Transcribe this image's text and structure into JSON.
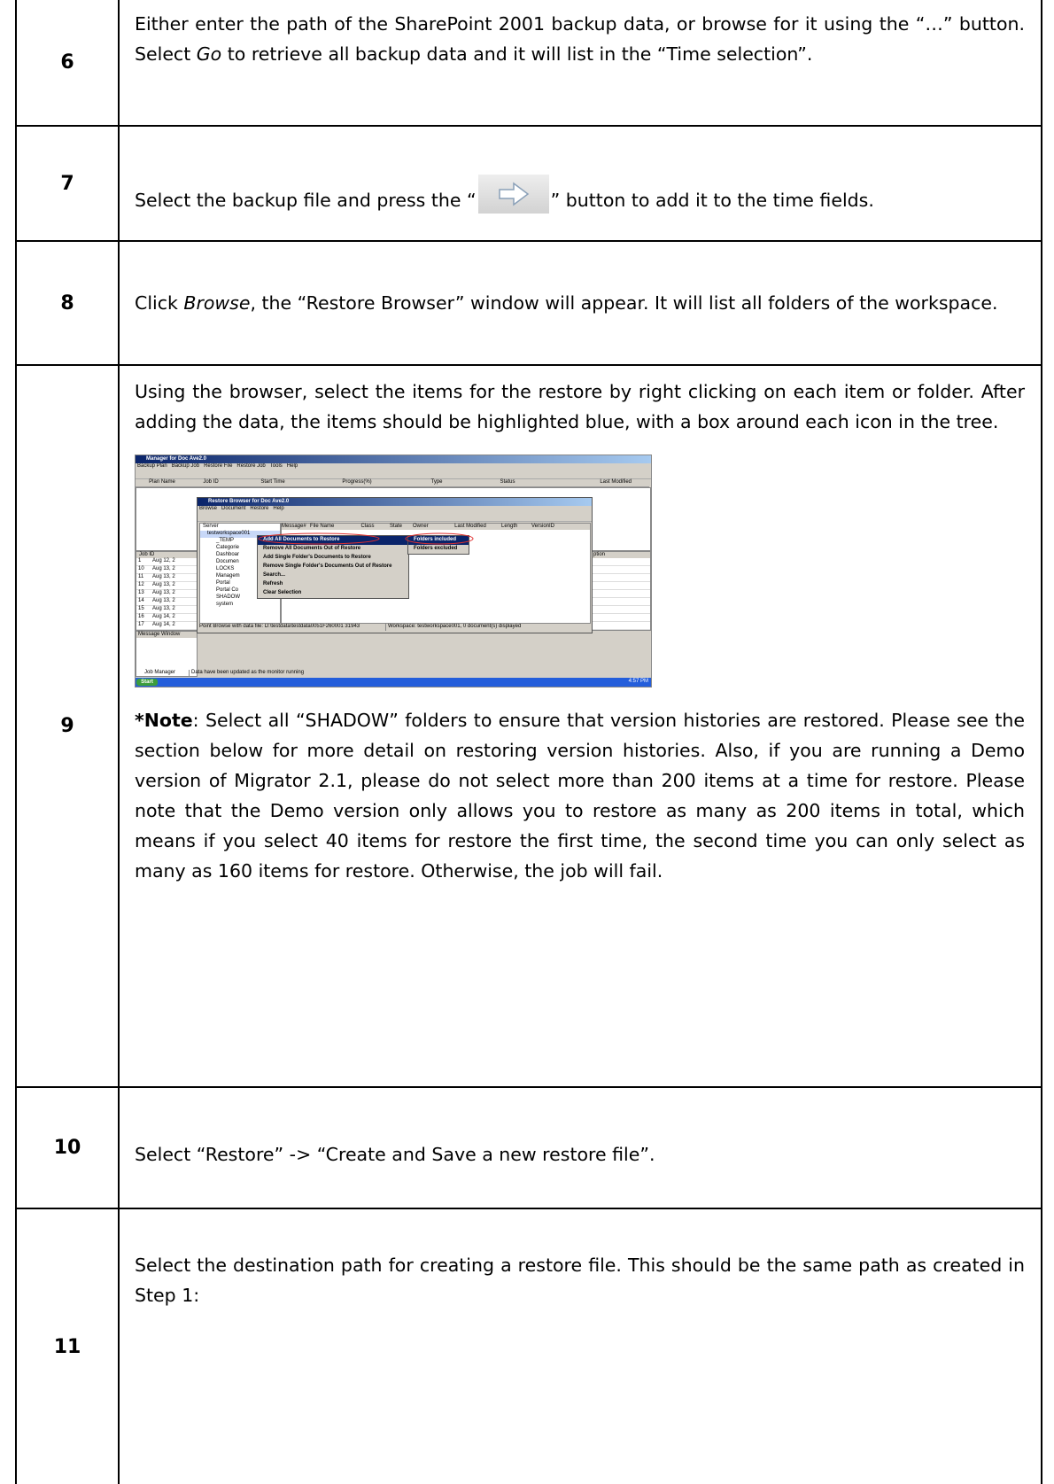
{
  "rows": [
    {
      "num": "6",
      "text_a": "Either enter the path of the SharePoint 2001 backup data, or browse for it using the “…” button. Select ",
      "text_em": "Go",
      "text_b": " to retrieve all backup data and it will list in the “Time selection”."
    },
    {
      "num": "7",
      "text_a": "Select the backup file and press the “",
      "text_b": "” button to add it to the time fields."
    },
    {
      "num": "8",
      "text_a": "Click ",
      "text_em": "Browse",
      "text_b": ", the “Restore Browser” window will appear. It will list all folders of the workspace."
    },
    {
      "num": "9",
      "text": "Using the browser, select the items for the restore by right clicking on each item or folder. After adding the data, the items should be highlighted blue, with a box around each icon in the tree.",
      "note_label": "*Note",
      "note_text": ": Select all “SHADOW” folders to ensure that version histories are restored. Please see the section below for more detail on restoring version histories. Also, if you are running a Demo version of Migrator 2.1, please do not select more than 200 items at a time for restore. Please note that the Demo version only allows you to restore as many as 200 items in total, which means if you select 40 items for restore the first time, the second time you can only select as many as 160 items for restore. Otherwise, the job will fail."
    },
    {
      "num": "10",
      "text": "Select “Restore” -> “Create and Save a new restore file”."
    },
    {
      "num": "11",
      "text": "Select the destination path for creating a restore file. This should be the same path as created in Step 1:"
    }
  ],
  "screenshot": {
    "title": "Manager for Doc Ave2.0",
    "menu": [
      "Backup Plan",
      "Backup Job",
      "Restore File",
      "Restore Job",
      "Tools",
      "Help"
    ],
    "columns": [
      "Plan Name",
      "Job ID",
      "Start Time",
      "Progress(%)",
      "Type",
      "Status",
      "Last Modified"
    ],
    "job_header": "Job ID",
    "job_rows": [
      [
        "1",
        "Aug 12, 2"
      ],
      [
        "10",
        "Aug 13, 2"
      ],
      [
        "11",
        "Aug 13, 2"
      ],
      [
        "12",
        "Aug 13, 2"
      ],
      [
        "13",
        "Aug 13, 2"
      ],
      [
        "14",
        "Aug 13, 2"
      ],
      [
        "15",
        "Aug 13, 2"
      ],
      [
        "16",
        "Aug 14, 2"
      ],
      [
        "17",
        "Aug 14, 2"
      ]
    ],
    "option_header": "ption",
    "message_window": "Message Window",
    "inner_title": "Restore Browser for Doc Ave2.0",
    "inner_menu": [
      "Browse",
      "Document",
      "Restore",
      "Help"
    ],
    "inner_columns": [
      "Message#",
      "File Name",
      "Class",
      "State",
      "Owner",
      "Last Modified",
      "Length",
      "VersionID"
    ],
    "tree": [
      "Server",
      "testworkspace001",
      "_TEMP",
      "Categorie",
      "Dashboar",
      "Documen",
      "LOCKS",
      "Managem",
      "Portal",
      "Portal Co",
      "SHADOW",
      "system"
    ],
    "context_menu": [
      "Add All Documents to Restore",
      "Remove All Documents Out of Restore",
      "Add Single Folder's Documents to Restore",
      "Remove Single Folder's Documents Out of Restore",
      "Search...",
      "Refresh",
      "Clear Selection"
    ],
    "submenu": [
      "Folders included",
      "Folders excluded"
    ],
    "inner_status_a": "Point Browse with data file: D:\\testdata\\testdata0051F260001 31943",
    "inner_status_b": "Workspace: testworkspace001, 0 document(s) displayed",
    "status_a": "Job Manager",
    "status_b": "Data have been updated as the monitor running",
    "start": "Start",
    "clock": "4:57 PM"
  }
}
